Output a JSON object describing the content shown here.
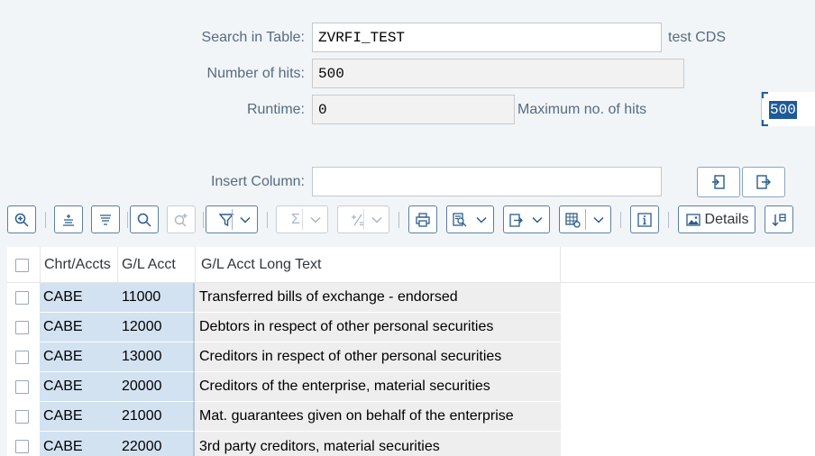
{
  "form": {
    "search_label": "Search in Table:",
    "search_value": "ZVRFI_TEST",
    "search_desc": "test CDS",
    "hits_label": "Number of hits:",
    "hits_value": "500",
    "runtime_label": "Runtime:",
    "runtime_value": "0",
    "max_hits_label": "Maximum no. of hits",
    "max_hits_value": "500",
    "insert_label": "Insert Column:",
    "insert_value": ""
  },
  "toolbar": {
    "details_label": "Details",
    "icons": [
      "zoom-in-icon",
      "sort-ascending-icon",
      "sort-descending-icon",
      "find-icon",
      "find-next-icon",
      "filter-icon",
      "sum-icon",
      "subtotal-icon",
      "print-icon",
      "print-preview-icon",
      "export-icon",
      "layout-icon",
      "information-icon",
      "details-icon",
      "graphic-icon"
    ]
  },
  "table": {
    "headers": [
      "Chrt/Accts",
      "G/L Acct",
      "G/L Acct Long Text"
    ],
    "rows": [
      [
        "CABE",
        "11000",
        "Transferred bills of exchange - endorsed"
      ],
      [
        "CABE",
        "12000",
        "Debtors in respect of other personal securities"
      ],
      [
        "CABE",
        "13000",
        "Creditors in respect of other personal securities"
      ],
      [
        "CABE",
        "20000",
        "Creditors of the enterprise, material securities"
      ],
      [
        "CABE",
        "21000",
        "Mat. guarantees given on behalf of the enterprise"
      ],
      [
        "CABE",
        "22000",
        "3rd party creditors, material securities"
      ]
    ]
  },
  "colors": {
    "background": "#f2f5f7",
    "key_column": "#d3e2f1",
    "text_column": "#eeeeee",
    "accent": "#2b5c8c",
    "selection": "#1e5a96"
  }
}
